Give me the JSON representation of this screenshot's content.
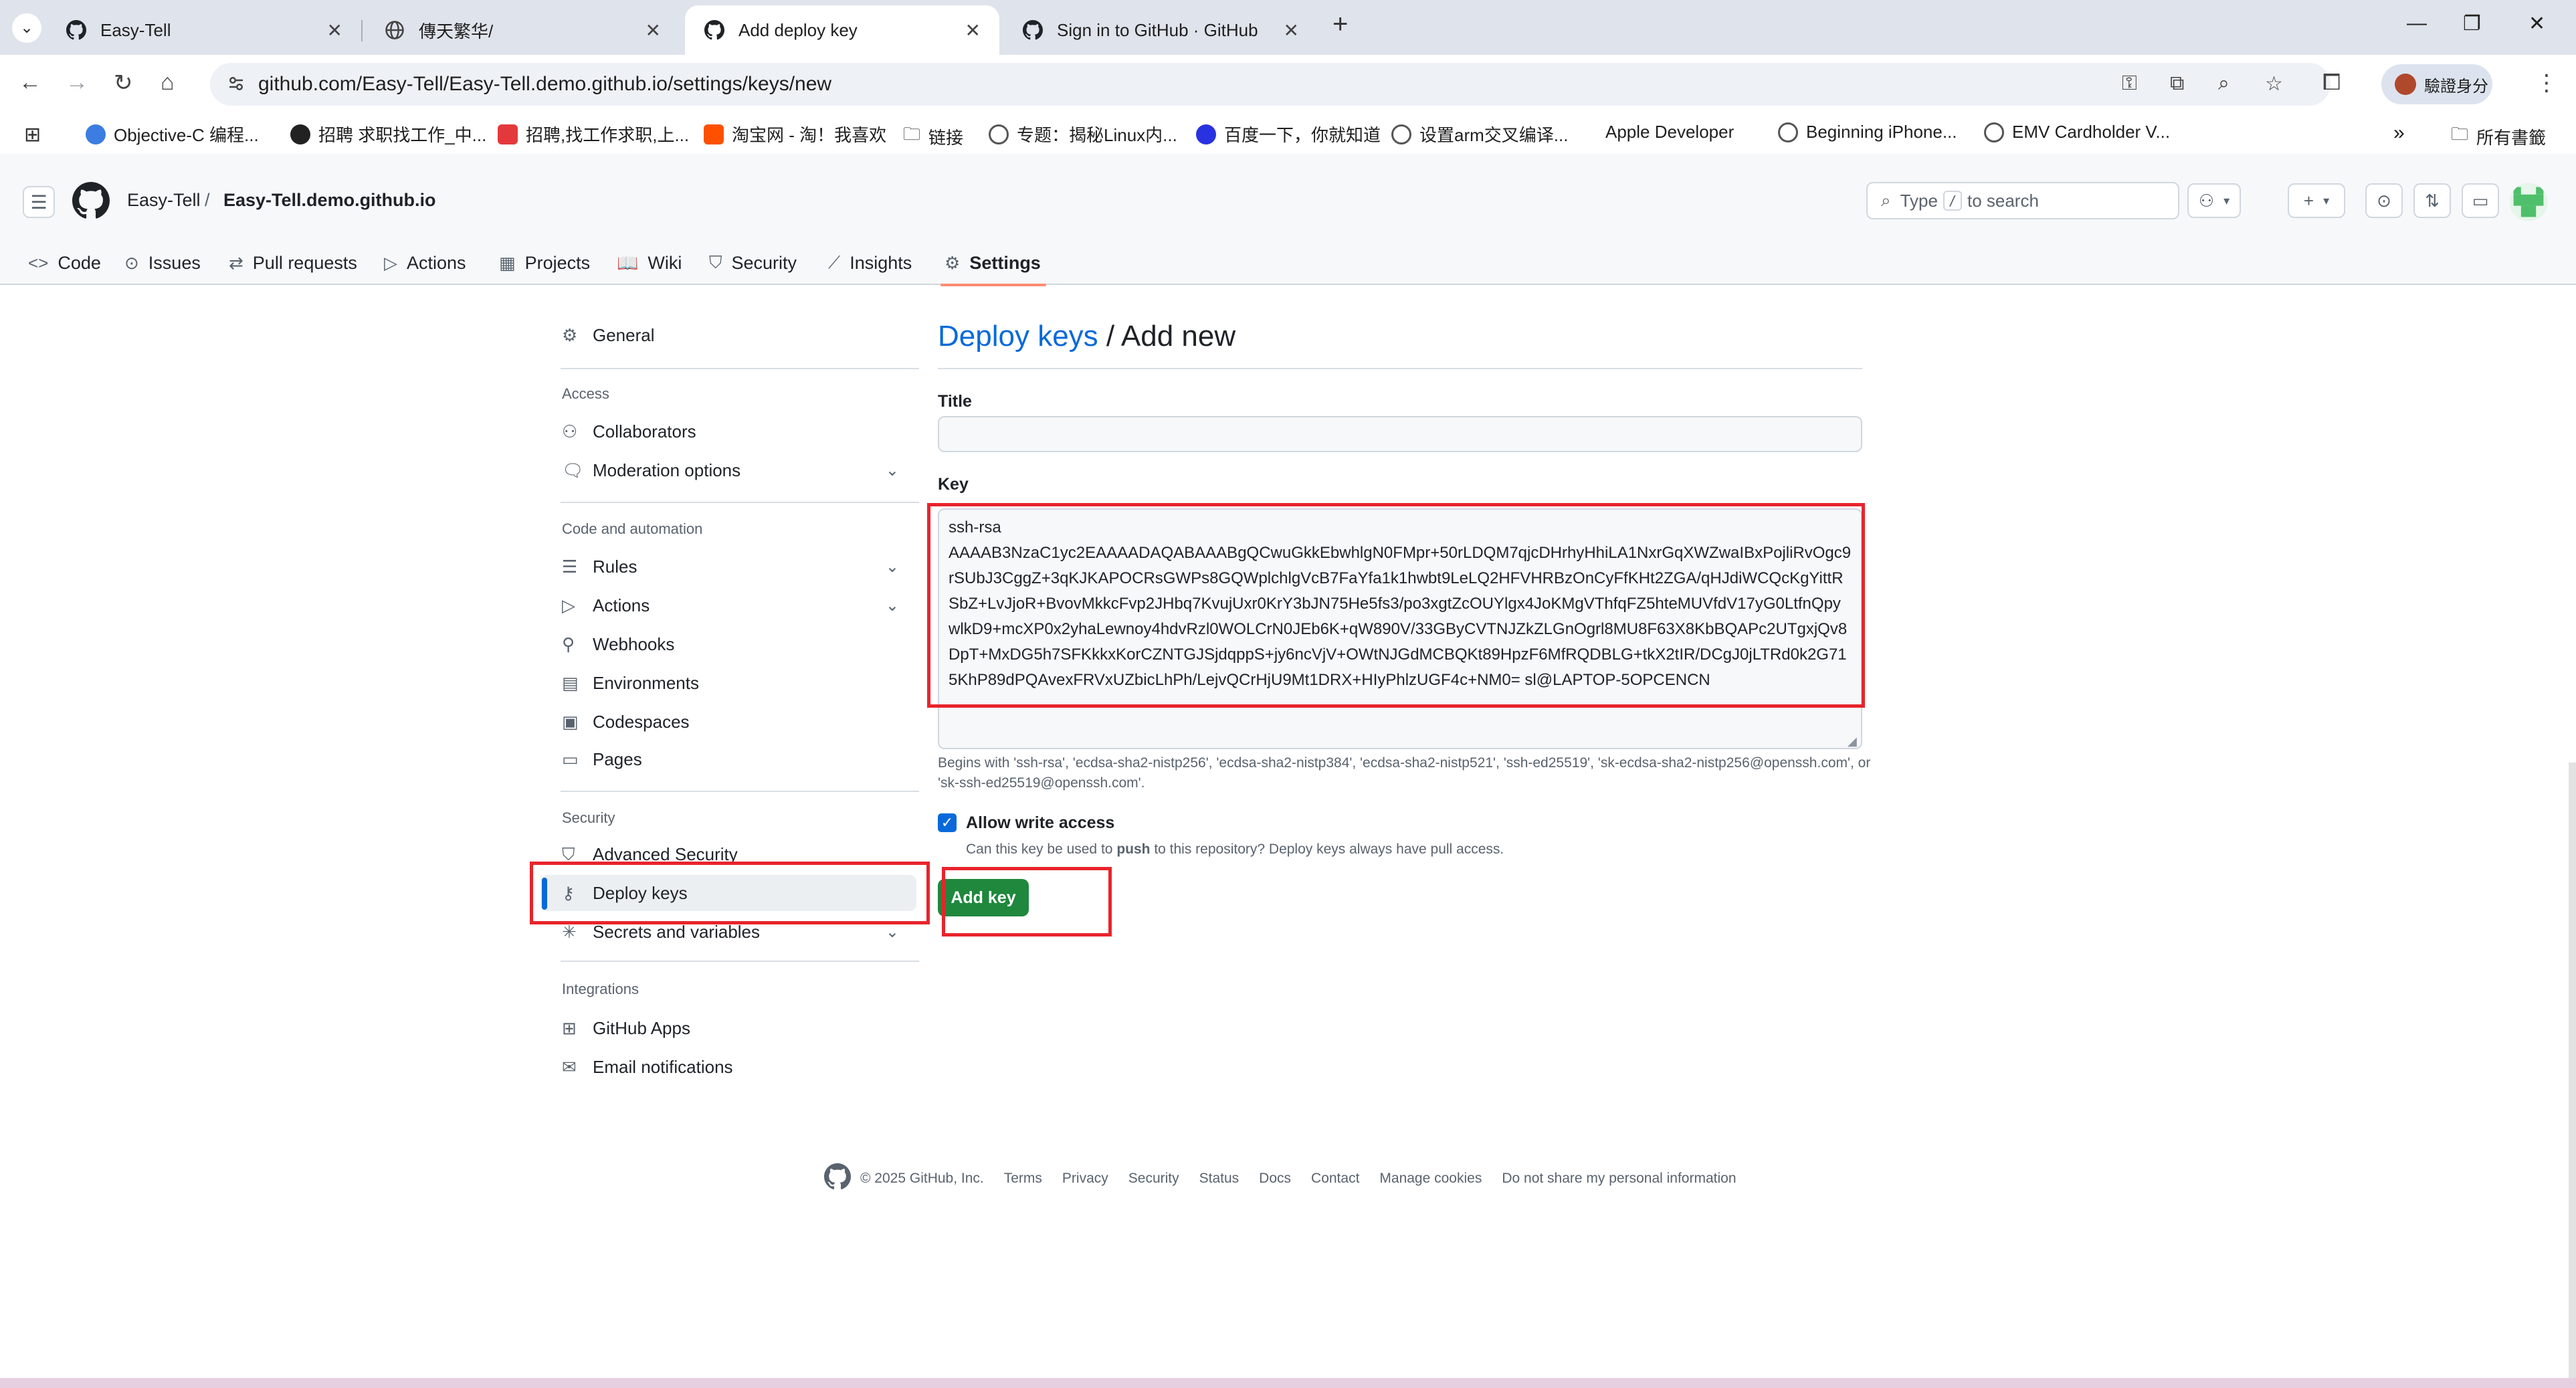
{
  "browser": {
    "tabs": [
      {
        "title": "Easy-Tell",
        "icon": "github-icon"
      },
      {
        "title": "傳天繁华/",
        "icon": "globe-icon"
      },
      {
        "title": "Add deploy key",
        "icon": "github-icon"
      },
      {
        "title": "Sign in to GitHub · GitHub",
        "icon": "github-icon"
      }
    ],
    "url": "github.com/Easy-Tell/Easy-Tell.demo.github.io/settings/keys/new",
    "profile_label": "驗證身分",
    "bookmarks": [
      {
        "label": "Objective-C 编程...",
        "color": "#3b7de0"
      },
      {
        "label": "招聘 求职找工作_中...",
        "color": "#222222"
      },
      {
        "label": "招聘,找工作求职,上...",
        "color": "#e4393c"
      },
      {
        "label": "淘宝网 - 淘！我喜欢",
        "color": "#ff5000"
      },
      {
        "label": "链接",
        "color": "#555555"
      },
      {
        "label": "专题：揭秘Linux内...",
        "color": "#555555"
      },
      {
        "label": "百度一下，你就知道",
        "color": "#2932e1"
      },
      {
        "label": "设置arm交叉编译...",
        "color": "#555555"
      },
      {
        "label": "Apple Developer",
        "color": "#999999"
      },
      {
        "label": "Beginning iPhone...",
        "color": "#555555"
      },
      {
        "label": "EMV Cardholder V...",
        "color": "#555555"
      }
    ],
    "all_bookmarks": "所有書籤"
  },
  "header": {
    "owner": "Easy-Tell",
    "separator": "/",
    "repo": "Easy-Tell.demo.github.io",
    "search_prefix": "Type",
    "search_key": "/",
    "search_suffix": "to search"
  },
  "repo_nav": [
    {
      "label": "Code",
      "icon": "code-icon"
    },
    {
      "label": "Issues",
      "icon": "issue-icon"
    },
    {
      "label": "Pull requests",
      "icon": "pull-request-icon"
    },
    {
      "label": "Actions",
      "icon": "play-icon"
    },
    {
      "label": "Projects",
      "icon": "table-icon"
    },
    {
      "label": "Wiki",
      "icon": "book-icon"
    },
    {
      "label": "Security",
      "icon": "shield-icon"
    },
    {
      "label": "Insights",
      "icon": "graph-icon"
    },
    {
      "label": "Settings",
      "icon": "gear-icon"
    }
  ],
  "sidebar": {
    "general": "General",
    "access_heading": "Access",
    "collaborators": "Collaborators",
    "moderation": "Moderation options",
    "code_heading": "Code and automation",
    "rules": "Rules",
    "actions": "Actions",
    "webhooks": "Webhooks",
    "environments": "Environments",
    "codespaces": "Codespaces",
    "pages": "Pages",
    "security_heading": "Security",
    "advanced_security": "Advanced Security",
    "deploy_keys": "Deploy keys",
    "secrets": "Secrets and variables",
    "integrations_heading": "Integrations",
    "github_apps": "GitHub Apps",
    "email_notifications": "Email notifications"
  },
  "form": {
    "title_link": "Deploy keys",
    "title_rest": " / Add new",
    "title_label": "Title",
    "title_value": "",
    "key_label": "Key",
    "key_value": "ssh-rsa\nAAAAB3NzaC1yc2EAAAADAQABAAABgQCwuGkkEbwhlgN0FMpr+50rLDQM7qjcDHrhyHhiLA1NxrGqXWZwaIBxPojliRvOgc9rSUbJ3CggZ+3qKJKAPOCRsGWPs8GQWplchlgVcB7FaYfa1k1hwbt9LeLQ2HFVHRBzOnCyFfKHt2ZGA/qHJdiWCQcKgYittRSbZ+LvJjoR+BvovMkkcFvp2JHbq7KvujUxr0KrY3bJN75He5fs3/po3xgtZcOUYlgx4JoKMgVThfqFZ5hteMUVfdV17yG0LtfnQpywlkD9+mcXP0x2yhaLewnoy4hdvRzl0WOLCrN0JEb6K+qW890V/33GByCVTNJZkZLGnOgrl8MU8F63X8KbBQAPc2UTgxjQv8DpT+MxDG5h7SFKkkxKorCZNTGJSjdqppS+jy6ncVjV+OWtNJGdMCBQKt89HpzF6MfRQDBLG+tkX2tIR/DCgJ0jLTRd0k2G715KhP89dPQAvexFRVxUZbicLhPh/LejvQCrHjU9Mt1DRX+HIyPhlzUGF4c+NM0= sl@LAPTOP-5OPCENCN",
    "key_hint": "Begins with 'ssh-rsa', 'ecdsa-sha2-nistp256', 'ecdsa-sha2-nistp384', 'ecdsa-sha2-nistp521', 'ssh-ed25519', 'sk-ecdsa-sha2-nistp256@openssh.com', or 'sk-ssh-ed25519@openssh.com'.",
    "write_access_label": "Allow write access",
    "write_access_checked": true,
    "write_note_before": "Can this key be used to ",
    "write_note_bold": "push",
    "write_note_after": " to this repository? Deploy keys always have pull access.",
    "submit": "Add key"
  },
  "footer": {
    "copyright": "© 2025 GitHub, Inc.",
    "links": [
      "Terms",
      "Privacy",
      "Security",
      "Status",
      "Docs",
      "Contact",
      "Manage cookies",
      "Do not share my personal information"
    ]
  },
  "colors": {
    "link": "#0969da",
    "primary_button": "#1f883d",
    "highlight": "#e8242c",
    "nav_underline": "#fd8c73"
  }
}
